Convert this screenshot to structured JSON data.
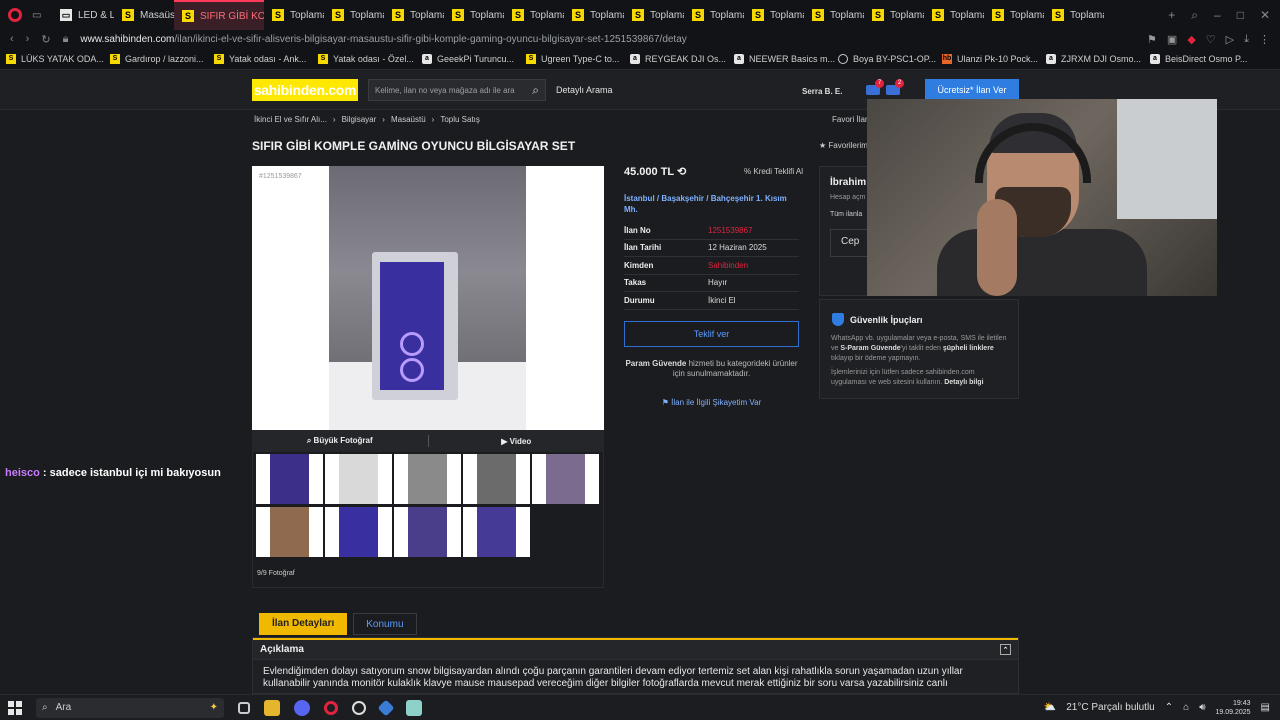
{
  "browser": {
    "tabs": [
      {
        "label": "LED & L",
        "active": false
      },
      {
        "label": "Masaüstü",
        "active": false
      },
      {
        "label": "SIFIR GİBİ KOMP",
        "active": true
      },
      {
        "label": "Toplama",
        "active": false
      },
      {
        "label": "Toplama",
        "active": false
      },
      {
        "label": "Toplama",
        "active": false
      },
      {
        "label": "Toplama",
        "active": false
      },
      {
        "label": "Toplama",
        "active": false
      },
      {
        "label": "Toplama",
        "active": false
      },
      {
        "label": "Toplama",
        "active": false
      },
      {
        "label": "Toplama",
        "active": false
      },
      {
        "label": "Toplama",
        "active": false
      },
      {
        "label": "Toplama",
        "active": false
      },
      {
        "label": "Toplama",
        "active": false
      },
      {
        "label": "Toplama",
        "active": false
      },
      {
        "label": "Toplama",
        "active": false
      },
      {
        "label": "Toplama",
        "active": false
      }
    ],
    "url_host": "www.sahibinden.com",
    "url_path": "/ilan/ikinci-el-ve-sifir-alisveris-bilgisayar-masaustu-sifir-gibi-komple-gaming-oyuncu-bilgisayar-set-1251539867/detay",
    "bookmarks": [
      {
        "label": "LÜKS YATAK ODA...",
        "icon": "S"
      },
      {
        "label": "Gardırop / lazzoni...",
        "icon": "S"
      },
      {
        "label": "Yatak odası - Ank...",
        "icon": "S"
      },
      {
        "label": "Yatak odası - Özel...",
        "icon": "S"
      },
      {
        "label": "GeeekPi Turuncu...",
        "icon": "a"
      },
      {
        "label": "Ugreen Type-C to...",
        "icon": "S"
      },
      {
        "label": "REYGEAK DJI Os...",
        "icon": "a"
      },
      {
        "label": "NEEWER Basics m...",
        "icon": "a"
      },
      {
        "label": "Boya BY-PSC1-OP...",
        "icon": "c"
      },
      {
        "label": "Ulanzi Pk-10 Pock...",
        "icon": "hb"
      },
      {
        "label": "ZJRXM DJI Osmo...",
        "icon": "a"
      },
      {
        "label": "BeisDirect Osmo P...",
        "icon": "a"
      }
    ]
  },
  "site": {
    "logo": "sahibinden.com",
    "search_placeholder": "Kelime, ilan no veya mağaza adı ile ara",
    "detailed_search": "Detaylı Arama",
    "user": "Serra B. E.",
    "notif_counts": [
      "7",
      "2"
    ],
    "post_button": "Ücretsiz* İlan Ver",
    "breadcrumbs": [
      "İkinci El ve Sıfır Alı...",
      "Bilgisayar",
      "Masaüstü",
      "Toplu Satış"
    ],
    "favorites_link": "Favori İlanl",
    "title": "SIFIR GİBİ KOMPLE GAMİNG OYUNCU BİLGİSAYAR SET",
    "fav_button": "Favorilerim"
  },
  "gallery": {
    "photo_id": "#1251539867",
    "big_photo": "Büyük Fotoğraf",
    "video": "Video",
    "count": "9/9 Fotoğraf"
  },
  "listing": {
    "price": "45.000 TL",
    "credit": "Kredi Teklifi Al",
    "location": "İstanbul  /  Başakşehir  /  Bahçeşehir 1. Kısım Mh.",
    "info_rows": [
      {
        "key": "İlan No",
        "value": "1251539867",
        "red": true
      },
      {
        "key": "İlan Tarihi",
        "value": "12 Haziran 2025",
        "red": false
      },
      {
        "key": "Kimden",
        "value": "Sahibinden",
        "red": true
      },
      {
        "key": "Takas",
        "value": "Hayır",
        "red": false
      },
      {
        "key": "Durumu",
        "value": "İkinci El",
        "red": false
      }
    ],
    "offer_button": "Teklif ver",
    "param_bold": "Param Güvende",
    "param_text": " hizmeti bu kategorideki ürünler için sunulmamaktadır.",
    "complaint": "İlan ile İlgili Şikayetim Var"
  },
  "seller": {
    "name": "İbrahim",
    "sub": "Hesap açm",
    "all_listings": "Tüm ilanla",
    "phone_label": "Cep"
  },
  "safety": {
    "title": "Güvenlik İpuçları",
    "t1a": "WhatsApp vb. uygulamalar veya e-posta, SMS ile iletilen ve ",
    "t1b": "S-Param Güvende",
    "t1c": "'yi taklit eden ",
    "t1d": "şüpheli linklere",
    "t1e": " tıklayıp bir ödeme yapmayın.",
    "t2a": "İşlemlerinizi için lütfen sadece sahibinden.com uygulaması ve web sitesini kullanın. ",
    "t2b": "Detaylı bilgi"
  },
  "chat": {
    "user": "heisco",
    "message": " : sadece istanbul içi mi bakıyosun"
  },
  "details": {
    "tab_details": "İlan Detayları",
    "tab_location": "Konumu",
    "section": "Açıklama",
    "text": "Evlendiğimden dolayı satıyorum snow bilgisayardan alındı çoğu parçanın garantileri devam ediyor tertemiz set alan kişi rahatlıkla sorun yaşamadan uzun yıllar kullanabilir yanında monitör kulaklık klavye mause mausepad vereceğim diğer bilgiler fotoğraflarda mevcut merak ettiğiniz bir soru varsa yazabilirsiniz canlı"
  },
  "taskbar": {
    "search": "Ara",
    "weather": "21°C  Parçalı bulutlu",
    "time": "19:43",
    "date": "19.09.2025"
  }
}
